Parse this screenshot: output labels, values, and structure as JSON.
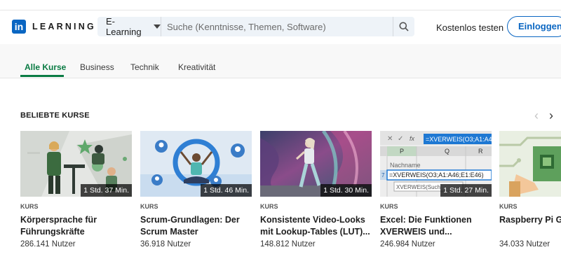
{
  "brand": {
    "logo_text": "in",
    "name": "LEARNING",
    "color": "#0a66c2"
  },
  "search": {
    "category": "E-Learning",
    "placeholder": "Suche (Kenntnisse, Themen, Software)"
  },
  "header": {
    "free_trial": "Kostenlos testen",
    "login": "Einloggen"
  },
  "tabs": [
    {
      "label": "Alle Kurse",
      "active": true
    },
    {
      "label": "Business",
      "active": false
    },
    {
      "label": "Technik",
      "active": false
    },
    {
      "label": "Kreativität",
      "active": false
    }
  ],
  "accent_color": "#0a7b43",
  "section": {
    "title": "BELIEBTE KURSE",
    "prev_icon": "chevron-left-icon",
    "next_icon": "chevron-right-icon"
  },
  "courses": [
    {
      "type": "KURS",
      "title": "Körpersprache für Führungskräfte",
      "users": "286.141 Nutzer",
      "duration": "1 Std. 37 Min."
    },
    {
      "type": "KURS",
      "title": "Scrum-Grundlagen: Der Scrum Master",
      "users": "36.918 Nutzer",
      "duration": "1 Std. 46 Min."
    },
    {
      "type": "KURS",
      "title": "Konsistente Video-Looks mit Lookup-Tables (LUT)...",
      "users": "148.812 Nutzer",
      "duration": "1 Std. 30 Min."
    },
    {
      "type": "KURS",
      "title": "Excel: Die Funktionen XVERWEIS und...",
      "users": "246.984 Nutzer",
      "duration": "1 Std. 27 Min.",
      "excel": {
        "formula": "=XVERWEIS(O3;A1:A46",
        "fx": "fx",
        "col_p": "P",
        "col_q": "Q",
        "col_r": "R",
        "row_num": "7",
        "label": "Nachname",
        "cell_formula": "=XVERWEIS(O3;A1:A46;E1:E46)",
        "hint": "XVERWEIS(Such"
      }
    },
    {
      "type": "KURS",
      "title": "Raspberry Pi G",
      "users": "34.033 Nutzer",
      "duration": ""
    }
  ]
}
